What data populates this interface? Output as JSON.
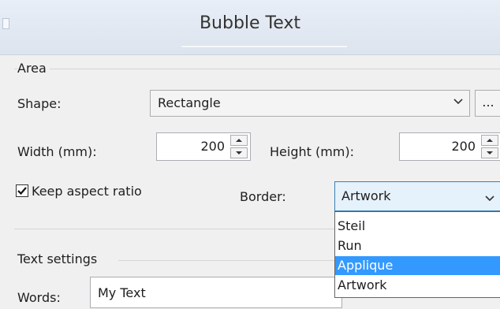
{
  "window": {
    "title": "Bubble Text"
  },
  "area": {
    "group_label": "Area",
    "shape_label": "Shape:",
    "shape_value": "Rectangle",
    "shape_more_label": "...",
    "width_label": "Width (mm):",
    "width_value": "200",
    "height_label": "Height (mm):",
    "height_value": "200",
    "keep_aspect_label": "Keep aspect ratio",
    "keep_aspect_checked": true,
    "border_label": "Border:",
    "border_value": "Artwork",
    "border_options": [
      "Steil",
      "Run",
      "Applique",
      "Artwork"
    ],
    "border_highlighted": "Applique"
  },
  "text_settings": {
    "group_label": "Text settings",
    "words_label": "Words:",
    "words_value": "My Text"
  },
  "colors": {
    "highlight": "#3399ff",
    "focus_border": "#3c7fb1"
  }
}
